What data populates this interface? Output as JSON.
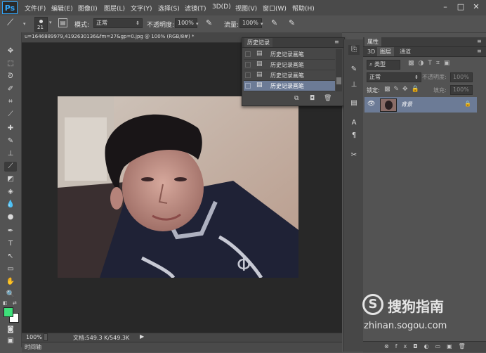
{
  "app": {
    "logo": "Ps",
    "menu": [
      "文件(F)",
      "编辑(E)",
      "图像(I)",
      "图层(L)",
      "文字(Y)",
      "选择(S)",
      "滤镜(T)",
      "3D(D)",
      "视图(V)",
      "窗口(W)",
      "帮助(H)"
    ],
    "window_controls": [
      "–",
      "□",
      "✕"
    ]
  },
  "options": {
    "brush_size": "21",
    "mode_label": "模式:",
    "mode_value": "正常",
    "opacity_label": "不透明度:",
    "opacity_value": "100%",
    "flow_label": "流量:",
    "flow_value": "100%"
  },
  "document": {
    "tab_title": "u=1646889979,4192630136&fm=27&gp=0.jpg @ 100% (RGB/8#) *",
    "zoom": "100%",
    "doc_info": "文档:549.3 K/549.3K",
    "timeline_label": "时间轴"
  },
  "history": {
    "title": "历史记录",
    "items": [
      "历史记录画笔",
      "历史记录画笔",
      "历史记录画笔",
      "历史记录画笔"
    ],
    "selected_index": 3
  },
  "panels": {
    "properties_tab": "属性",
    "tabs": [
      "3D",
      "图层",
      "通道"
    ],
    "active_tab": "图层",
    "kind_filter": "类型",
    "blend_mode": "正常",
    "opacity_label": "不透明度:",
    "opacity_value": "100%",
    "lock_label": "锁定:",
    "fill_label": "填充:",
    "fill_value": "100%",
    "layer_name": "背景"
  },
  "watermark": {
    "brand": "搜狗指南",
    "url": "zhinan.sogou.com"
  },
  "colors": {
    "foreground": "#3ee07a",
    "background": "#ffffff",
    "selection": "#6c7b96",
    "accent": "#31a8ff"
  }
}
